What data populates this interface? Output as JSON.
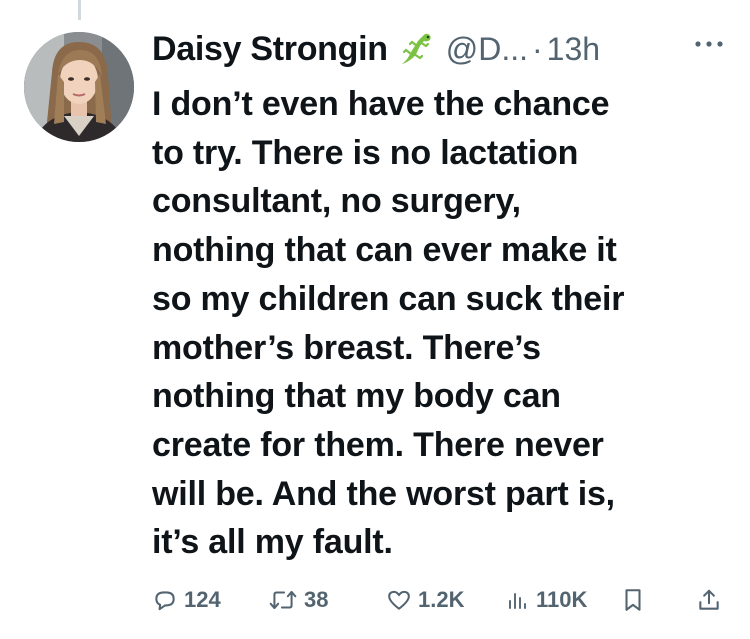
{
  "tweet": {
    "display_name": "Daisy Strongin",
    "name_emoji": "lizard-emoji",
    "handle": "@D...",
    "separator": "·",
    "time": "13h",
    "text": "I don’t even have the chance\nto try. There is no lactation\nconsultant, no surgery,\nnothing that can ever make it\nso my children can suck their\nmother’s breast. There’s\nnothing that my body can\ncreate for them. There never\nwill be. And the worst part is,\nit’s all my fault."
  },
  "actions": {
    "replies": "124",
    "reposts": "38",
    "likes": "1.2K",
    "views": "110K"
  },
  "icons": {
    "reply": "reply-icon",
    "repost": "repost-icon",
    "like": "heart-icon",
    "views": "views-icon",
    "bookmark": "bookmark-icon",
    "share": "share-icon",
    "more": "more-icon"
  },
  "colors": {
    "text": "#0f1419",
    "secondary": "#536471",
    "thread_line": "#cfd9de",
    "emoji_green": "#7cc242"
  }
}
